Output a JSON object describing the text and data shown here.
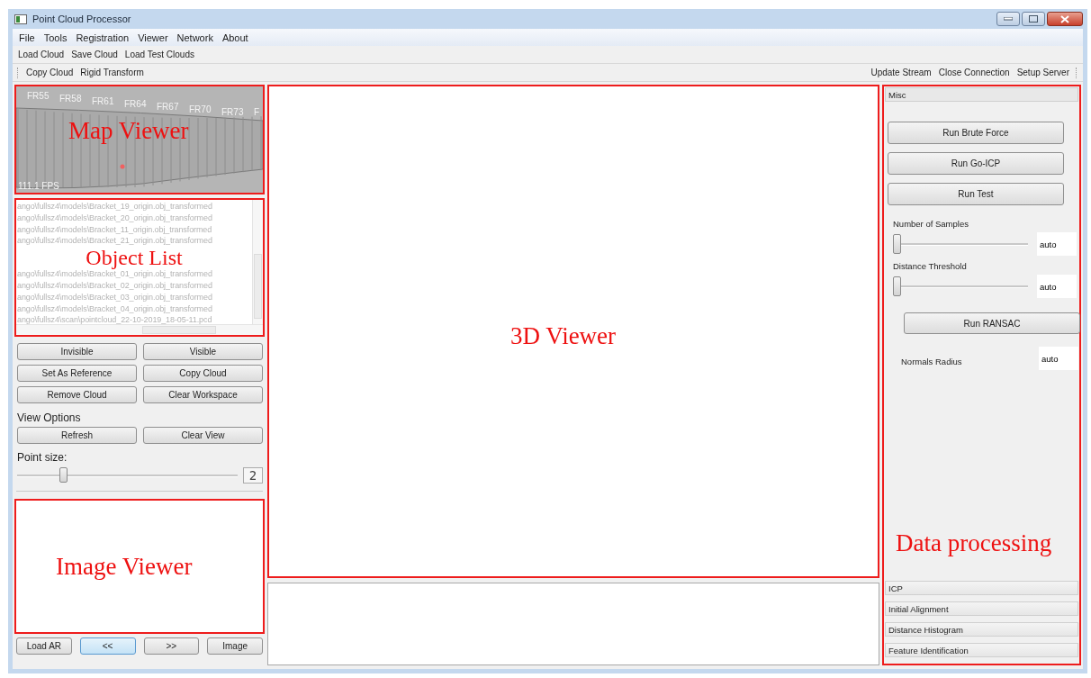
{
  "window": {
    "title": "Point Cloud Processor"
  },
  "menu": [
    "File",
    "Tools",
    "Registration",
    "Viewer",
    "Network",
    "About"
  ],
  "toolbar_1": [
    "Load Cloud",
    "Save Cloud",
    "Load Test Clouds"
  ],
  "toolbar_2": {
    "left": [
      "Copy Cloud",
      "Rigid Transform"
    ],
    "right": [
      "Update Stream",
      "Close Connection",
      "Setup Server"
    ]
  },
  "map_viewer": {
    "annotation": "Map Viewer",
    "frame_labels": [
      "FR55",
      "FR58",
      "FR61",
      "FR64",
      "FR67",
      "FR70",
      "FR73",
      "F"
    ],
    "fps": "111.1 FPS"
  },
  "object_list": {
    "annotation": "Object List",
    "items": [
      "ango\\fullsz4\\models\\Bracket_19_origin.obj_transformed",
      "ango\\fullsz4\\models\\Bracket_20_origin.obj_transformed",
      "ango\\fullsz4\\models\\Bracket_11_origin.obj_transformed",
      "ango\\fullsz4\\models\\Bracket_21_origin.obj_transformed",
      "ango\\fullsz4\\models\\Bracket_01_origin.obj_transformed",
      "ango\\fullsz4\\models\\Bracket_02_origin.obj_transformed",
      "ango\\fullsz4\\models\\Bracket_03_origin.obj_transformed",
      "ango\\fullsz4\\models\\Bracket_04_origin.obj_transformed",
      "ango\\fullsz4\\scan\\pointcloud_22-10-2019_18-05-11.pcd"
    ]
  },
  "object_buttons": [
    "Invisible",
    "Visible",
    "Set As Reference",
    "Copy Cloud",
    "Remove Cloud",
    "Clear Workspace"
  ],
  "view_options": {
    "heading": "View Options",
    "buttons": [
      "Refresh",
      "Clear View"
    ]
  },
  "point_size": {
    "label": "Point size:",
    "level": 0.2,
    "reading": "2"
  },
  "image_viewer": {
    "annotation": "Image Viewer"
  },
  "image_buttons": [
    {
      "label": "Load AR",
      "focused": false
    },
    {
      "label": "<<",
      "focused": true
    },
    {
      "label": ">>",
      "focused": false
    },
    {
      "label": "Image",
      "focused": false
    }
  ],
  "viewer_3d": {
    "annotation": "3D Viewer"
  },
  "data_processing": {
    "annotation": "Data processing",
    "sections": [
      {
        "title": "Misc",
        "expanded": true
      },
      {
        "title": "ICP",
        "expanded": false
      },
      {
        "title": "Initial Alignment",
        "expanded": false
      },
      {
        "title": "Distance Histogram",
        "expanded": false
      },
      {
        "title": "Feature Identification",
        "expanded": false
      }
    ],
    "misc_buttons": [
      "Run Brute Force",
      "Run Go-ICP",
      "Run Test"
    ],
    "sliders": [
      {
        "label": "Number of Samples",
        "level": 0,
        "value": "auto"
      },
      {
        "label": "Distance Threshold",
        "level": 0,
        "value": "auto"
      }
    ],
    "ransac_button": "Run RANSAC",
    "normals_radius": {
      "label": "Normals Radius",
      "value": "auto"
    }
  }
}
